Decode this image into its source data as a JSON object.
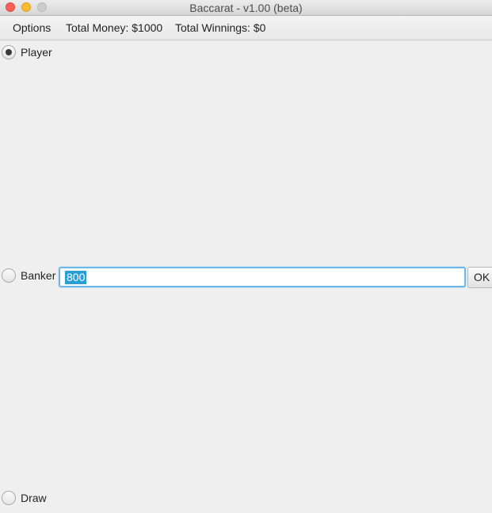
{
  "window": {
    "title": "Baccarat - v1.00 (beta)"
  },
  "menubar": {
    "options_label": "Options",
    "total_money": "Total Money: $1000",
    "total_winnings": "Total Winnings: $0"
  },
  "bet_options": {
    "player_label": "Player",
    "banker_label": "Banker",
    "draw_label": "Draw",
    "selected": "Player"
  },
  "bet_input": {
    "value": "800"
  },
  "ok_button": {
    "label": "OK"
  },
  "colors": {
    "selection": "#2a9fd6",
    "focus_ring": "#6fb8e4",
    "close": "#fc5f57",
    "minimize": "#fdbc2e",
    "zoom": "#cdcdcd"
  }
}
